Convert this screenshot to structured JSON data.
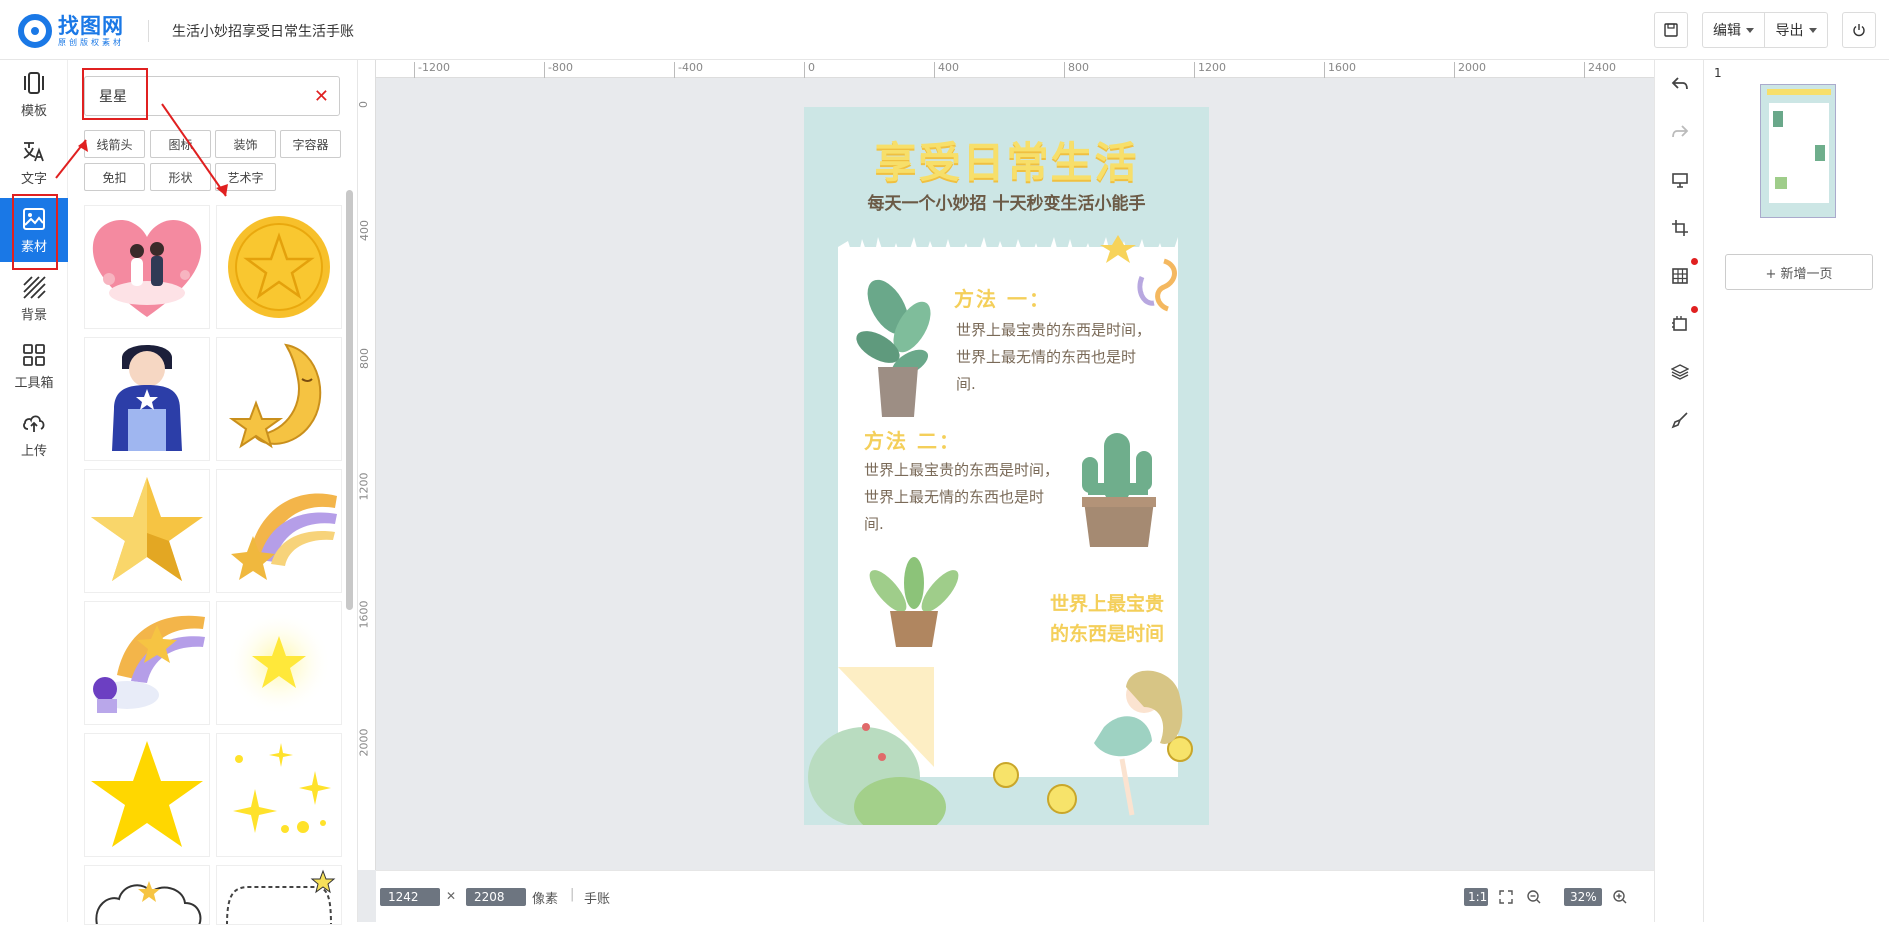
{
  "header": {
    "logo_name": "找图网",
    "logo_sub": "原创版权素材",
    "doc_title": "生活小妙招享受日常生活手账",
    "edit_label": "编辑",
    "export_label": "导出"
  },
  "rail": [
    {
      "label": "模板",
      "icon": "template-icon"
    },
    {
      "label": "文字",
      "icon": "text-icon"
    },
    {
      "label": "素材",
      "icon": "image-icon"
    },
    {
      "label": "背景",
      "icon": "background-icon"
    },
    {
      "label": "工具箱",
      "icon": "toolbox-icon"
    },
    {
      "label": "上传",
      "icon": "upload-icon"
    }
  ],
  "panel": {
    "search_value": "星星",
    "tags": [
      "线箭头",
      "图标",
      "装饰",
      "字容器",
      "免扣",
      "形状",
      "艺术字"
    ],
    "items": [
      "couple-heart",
      "gold-star-coin",
      "boy-holding-star",
      "moon-and-star",
      "golden-star",
      "shooting-star",
      "astronaut-shooting-star",
      "glowing-star",
      "yellow-star",
      "sparkles",
      "cloud-frame",
      "dotted-frame"
    ]
  },
  "ruler": {
    "top": [
      "-1200",
      "-800",
      "-400",
      "0",
      "400",
      "800",
      "1200",
      "1600",
      "2000",
      "2400"
    ],
    "left": [
      "0",
      "400",
      "800",
      "1200",
      "1600",
      "2000"
    ]
  },
  "poster": {
    "title": "享受日常生活",
    "subtitle": "每天一个小妙招 十天秒变生活小能手",
    "m1_heading": "方法 一：",
    "m1_body": "世界上最宝贵的东西是时间，世界上最无情的东西也是时间.",
    "m2_heading": "方法 二：",
    "m2_body": "世界上最宝贵的东西是时间，世界上最无情的东西也是时间.",
    "footer_line1": "世界上最宝贵",
    "footer_line2": "的东西是时间"
  },
  "bottombar": {
    "width": "1242",
    "times": "✕",
    "height": "2208",
    "unit": "像素",
    "sep": "|",
    "type": "手账",
    "ratio": "1:1",
    "zoom": "32%"
  },
  "pages": {
    "page_number": "1",
    "add_page": "+ 新增一页"
  },
  "colors": {
    "brand": "#1a78e6",
    "annotation": "#e02020",
    "poster_bg": "#cce6e5",
    "title_yellow": "#f7df6a"
  }
}
